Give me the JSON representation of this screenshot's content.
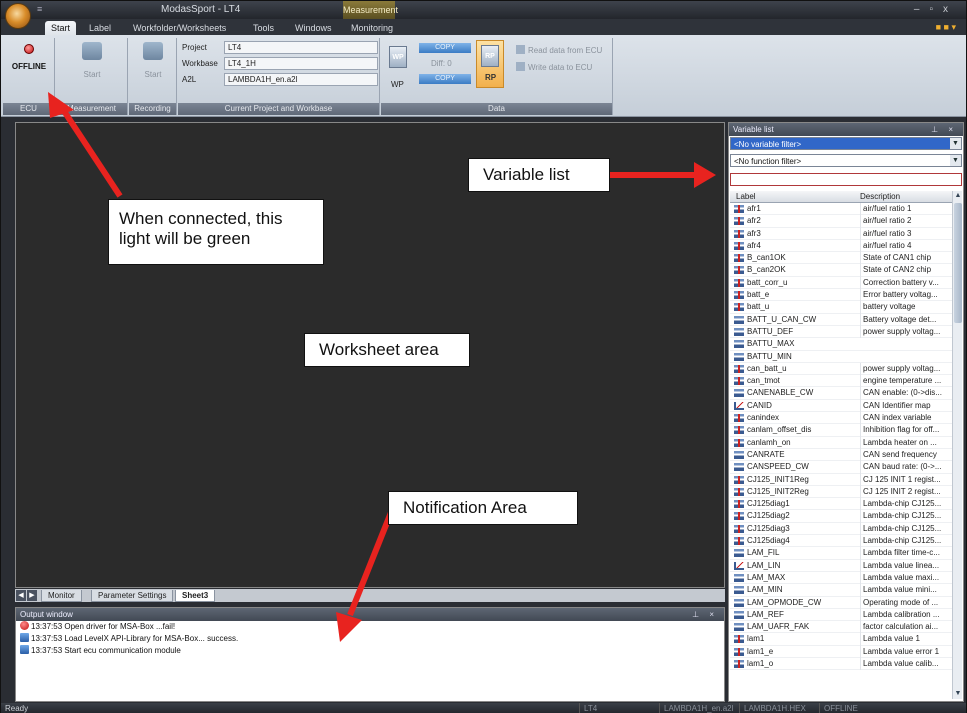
{
  "window": {
    "title": "ModasSport - LT4",
    "contextual_tab": "Measurement",
    "quick_access": "≡"
  },
  "ribbon_tabs": [
    "Start",
    "Label",
    "Workfolder/Worksheets",
    "Tools",
    "Windows",
    "Monitoring"
  ],
  "ribbon": {
    "ecu": {
      "status": "OFFLINE",
      "group_label": "ECU"
    },
    "measurement": {
      "button": "Start",
      "group_label": "Measurement"
    },
    "recording": {
      "button": "Start",
      "group_label": "Recording"
    },
    "project": {
      "group_label": "Current Project and Workbase",
      "project_label": "Project",
      "project_value": "LT4",
      "workbase_label": "Workbase",
      "workbase_value": "LT4_1H",
      "a2l_label": "A2L",
      "a2l_value": "LAMBDA1H_en.a2l"
    },
    "data": {
      "group_label": "Data",
      "wp": "WP",
      "rp": "RP",
      "copy_top": "COPY",
      "diff": "Diff: 0",
      "copy_bottom": "COPY",
      "read_ecu": "Read data from ECU",
      "write_ecu": "Write data to ECU"
    }
  },
  "sheet_tabs": [
    "Monitor",
    "Parameter Settings",
    "Sheet3"
  ],
  "output_window": {
    "title": "Output window",
    "lines": [
      {
        "kind": "error",
        "text": "13:37:53 Open driver for MSA-Box ...fail!"
      },
      {
        "kind": "info",
        "text": "13:37:53 Load LevelX API-Library for MSA-Box... success."
      },
      {
        "kind": "info",
        "text": "13:37:53 Start ecu communication module"
      }
    ]
  },
  "variable_list": {
    "title": "Variable list",
    "variable_filter": "<No variable filter>",
    "function_filter": "<No function filter>",
    "columns": [
      "Label",
      "Description"
    ],
    "rows": [
      {
        "icon": "meas",
        "label": "afr1",
        "desc": "air/fuel ratio 1"
      },
      {
        "icon": "meas",
        "label": "afr2",
        "desc": "air/fuel ratio 2"
      },
      {
        "icon": "meas",
        "label": "afr3",
        "desc": "air/fuel ratio 3"
      },
      {
        "icon": "meas",
        "label": "afr4",
        "desc": "air/fuel ratio 4"
      },
      {
        "icon": "meas",
        "label": "B_can1OK",
        "desc": "State of CAN1 chip"
      },
      {
        "icon": "meas",
        "label": "B_can2OK",
        "desc": "State of CAN2 chip"
      },
      {
        "icon": "meas",
        "label": "batt_corr_u",
        "desc": "Correction battery v..."
      },
      {
        "icon": "meas",
        "label": "batt_e",
        "desc": "Error battery voltag..."
      },
      {
        "icon": "meas",
        "label": "batt_u",
        "desc": "battery voltage"
      },
      {
        "icon": "scalar",
        "label": "BATT_U_CAN_CW",
        "desc": "Battery voltage det..."
      },
      {
        "icon": "scalar",
        "label": "BATTU_DEF",
        "desc": "power supply voltag..."
      },
      {
        "icon": "scalar",
        "label": "BATTU_MAX",
        "desc": ""
      },
      {
        "icon": "scalar",
        "label": "BATTU_MIN",
        "desc": ""
      },
      {
        "icon": "meas",
        "label": "can_batt_u",
        "desc": "power supply voltag..."
      },
      {
        "icon": "meas",
        "label": "can_tmot",
        "desc": "engine temperature ..."
      },
      {
        "icon": "scalar",
        "label": "CANENABLE_CW",
        "desc": "CAN enable: (0->dis..."
      },
      {
        "icon": "map",
        "label": "CANID",
        "desc": "CAN Identifier map"
      },
      {
        "icon": "meas",
        "label": "canindex",
        "desc": "CAN index variable"
      },
      {
        "icon": "meas",
        "label": "canlam_offset_dis",
        "desc": "Inhibition flag for off..."
      },
      {
        "icon": "meas",
        "label": "canlamh_on",
        "desc": "Lambda heater on ..."
      },
      {
        "icon": "scalar",
        "label": "CANRATE",
        "desc": "CAN send frequency"
      },
      {
        "icon": "scalar",
        "label": "CANSPEED_CW",
        "desc": "CAN baud rate: (0->..."
      },
      {
        "icon": "meas",
        "label": "CJ125_INIT1Reg",
        "desc": "CJ 125 INIT 1 regist..."
      },
      {
        "icon": "meas",
        "label": "CJ125_INIT2Reg",
        "desc": "CJ 125 INIT 2 regist..."
      },
      {
        "icon": "meas",
        "label": "CJ125diag1",
        "desc": "Lambda-chip CJ125..."
      },
      {
        "icon": "meas",
        "label": "CJ125diag2",
        "desc": "Lambda-chip CJ125..."
      },
      {
        "icon": "meas",
        "label": "CJ125diag3",
        "desc": "Lambda-chip CJ125..."
      },
      {
        "icon": "meas",
        "label": "CJ125diag4",
        "desc": "Lambda-chip CJ125..."
      },
      {
        "icon": "scalar",
        "label": "LAM_FIL",
        "desc": "Lambda filter time-c..."
      },
      {
        "icon": "map",
        "label": "LAM_LIN",
        "desc": "Lambda value linea..."
      },
      {
        "icon": "scalar",
        "label": "LAM_MAX",
        "desc": "Lambda value maxi..."
      },
      {
        "icon": "scalar",
        "label": "LAM_MIN",
        "desc": "Lambda value mini..."
      },
      {
        "icon": "scalar",
        "label": "LAM_OPMODE_CW",
        "desc": "Operating mode of ..."
      },
      {
        "icon": "scalar",
        "label": "LAM_REF",
        "desc": "Lambda calibration ..."
      },
      {
        "icon": "scalar",
        "label": "LAM_UAFR_FAK",
        "desc": "factor calculation ai..."
      },
      {
        "icon": "meas",
        "label": "lam1",
        "desc": "Lambda value 1"
      },
      {
        "icon": "meas",
        "label": "lam1_e",
        "desc": "Lambda value error 1"
      },
      {
        "icon": "meas",
        "label": "lam1_o",
        "desc": "Lambda value calib..."
      }
    ]
  },
  "status_bar": {
    "ready": "Ready",
    "project": "LT4",
    "a2l": "LAMBDA1H_en.a2l",
    "hex": "LAMBDA1H.HEX",
    "state": "OFFLINE"
  },
  "annotations": {
    "light": "When connected, this light will be green",
    "variable_list": "Variable list",
    "worksheet": "Worksheet area",
    "notification": "Notification Area",
    "arrow_color": "#e8231f"
  }
}
